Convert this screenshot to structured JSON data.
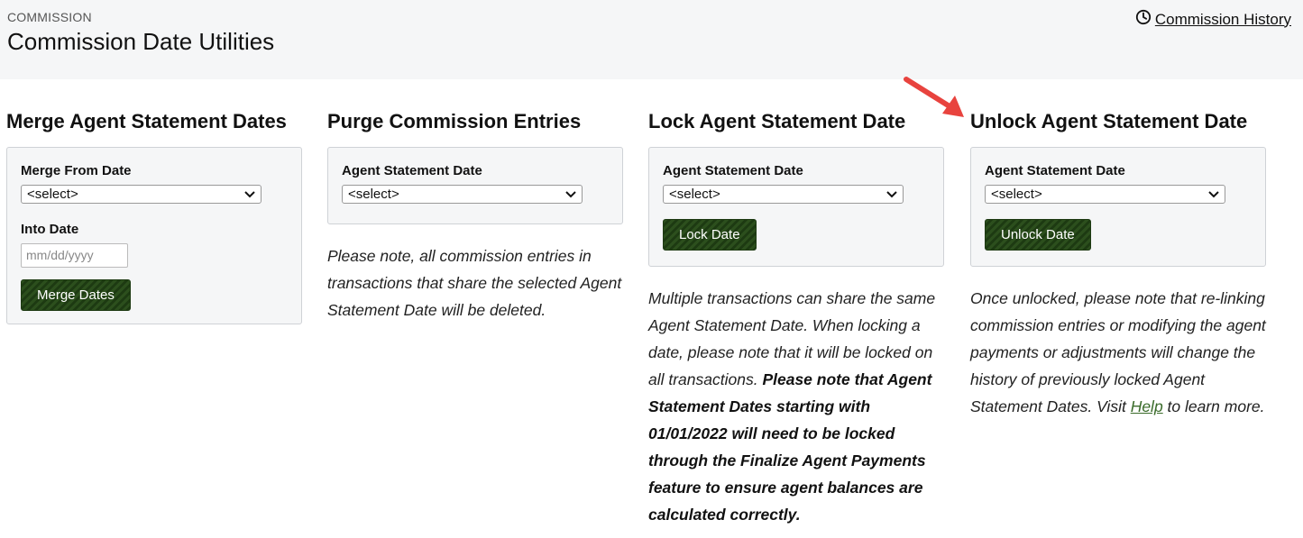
{
  "header": {
    "breadcrumb": "COMMISSION",
    "title": "Commission Date Utilities",
    "history_link": "Commission History"
  },
  "merge": {
    "heading": "Merge Agent Statement Dates",
    "from_label": "Merge From Date",
    "from_value": "<select>",
    "into_label": "Into Date",
    "into_placeholder": "mm/dd/yyyy",
    "button": "Merge Dates"
  },
  "purge": {
    "heading": "Purge Commission Entries",
    "label": "Agent Statement Date",
    "value": "<select>",
    "note": "Please note, all commission entries in transactions that share the selected Agent Statement Date will be deleted."
  },
  "lock": {
    "heading": "Lock Agent Statement Date",
    "label": "Agent Statement Date",
    "value": "<select>",
    "button": "Lock Date",
    "note_plain": "Multiple transactions can share the same Agent Statement Date. When locking a date, please note that it will be locked on all transactions. ",
    "note_bold": "Please note that Agent Statement Dates starting with 01/01/2022 will need to be locked through the Finalize Agent Payments feature to ensure agent balances are calculated correctly."
  },
  "unlock": {
    "heading": "Unlock Agent Statement Date",
    "label": "Agent Statement Date",
    "value": "<select>",
    "button": "Unlock Date",
    "note_before": "Once unlocked, please note that re-linking commission entries or modifying the agent payments or adjustments will change the history of previously locked Agent Statement Dates. Visit ",
    "note_link": "Help",
    "note_after": " to learn more."
  },
  "icons": {
    "history": "clock-icon",
    "select_caret": "chevron-down-icon",
    "annotation": "red-arrow-icon"
  },
  "colors": {
    "button_bg": "#2c4f1d",
    "topbar_bg": "#f5f6f7",
    "arrow": "#e8433e",
    "link": "#3a6b2a"
  }
}
